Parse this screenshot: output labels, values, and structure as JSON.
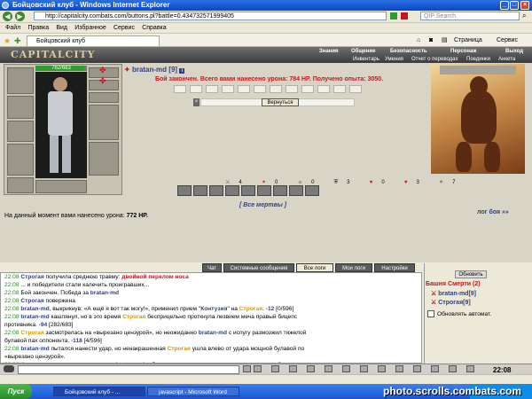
{
  "window": {
    "title": "Бойцовский клуб - Windows Internet Explorer"
  },
  "browser": {
    "address": "http://capitalcity.combats.com/buttons.pl?battle=0.434732571999405",
    "search_placeholder": "QIP Search",
    "menu": [
      "Файл",
      "Правка",
      "Вид",
      "Избранное",
      "Сервис",
      "Справка"
    ],
    "tab_title": "Бойцовский клуб",
    "page_menu": "Страница",
    "tools_menu": "Сервис"
  },
  "game": {
    "logo": "CAPITALCITY",
    "nav_top": [
      "Знания",
      "Общение",
      "Безопасность",
      "Персонаж",
      "Выход"
    ],
    "nav_sub": [
      "Инвентарь",
      "Умения",
      "Отчет о переводах",
      "Поединки",
      "Анкета"
    ],
    "hp_text": "762/683",
    "hp_fraction": 0.95,
    "player_name": "bratan-md",
    "player_level": "[9]",
    "battle_status": "Бой закончен. Всего вами нанесено урона: 784 HP. Получено опыта: 3050.",
    "back_button": "Вернуться",
    "stats": [
      "4",
      "0",
      "0",
      "3",
      "0",
      "3",
      "7"
    ],
    "all_dead": "[ Все мертвы ]",
    "battle_link": "лог боя »»",
    "damage_label": "На данный момент вами нанесено урона: ",
    "damage_value": "772 HP."
  },
  "chat": {
    "tabs": [
      "Чат",
      "Системные сообщения",
      "Все логи",
      "Мои логи",
      "Настройки"
    ],
    "lines": [
      {
        "time": "22:08",
        "parts": [
          {
            "t": "Строгая",
            "c": "nm"
          },
          {
            "t": " получила среднюю травму: ",
            "c": ""
          },
          {
            "t": "двойной перелом носа",
            "c": "red"
          }
        ]
      },
      {
        "time": "22:08",
        "parts": [
          {
            "t": "... и победители стали калечить проигравших...",
            "c": ""
          }
        ]
      },
      {
        "time": "22:08",
        "parts": [
          {
            "t": "Бой закончен. Победа за ",
            "c": ""
          },
          {
            "t": "bratan-md",
            "c": "nm"
          }
        ]
      },
      {
        "time": "22:08",
        "parts": [
          {
            "t": "Строгая",
            "c": "nm"
          },
          {
            "t": " повержена",
            "c": ""
          }
        ]
      },
      {
        "time": "22:08",
        "parts": [
          {
            "t": "bratan-md",
            "c": "nm"
          },
          {
            "t": ", выкрикнув: «А ещё я вот так могу!», применил прием \"",
            "c": ""
          },
          {
            "t": "Контузия",
            "c": "nm"
          },
          {
            "t": "\" на ",
            "c": ""
          },
          {
            "t": "Строгая",
            "c": "nm2"
          },
          {
            "t": ". ",
            "c": ""
          },
          {
            "t": "-12",
            "c": "blue"
          },
          {
            "t": " [0/596]",
            "c": ""
          }
        ]
      },
      {
        "time": "22:08",
        "parts": [
          {
            "t": "bratan-md",
            "c": "nm"
          },
          {
            "t": " кашлянул, но в это время ",
            "c": ""
          },
          {
            "t": "Строгая",
            "c": "nm2"
          },
          {
            "t": " бесприцельно проткнула лезвием меча правый бицепс",
            "c": ""
          }
        ]
      },
      {
        "time": "",
        "parts": [
          {
            "t": "противника. ",
            "c": ""
          },
          {
            "t": "-94",
            "c": "blue"
          },
          {
            "t": " [282/683]",
            "c": ""
          }
        ]
      },
      {
        "time": "22:08",
        "parts": [
          {
            "t": "Строгая",
            "c": "nm2"
          },
          {
            "t": " засмотрелась на «вырезано цензурой», но неожиданно ",
            "c": ""
          },
          {
            "t": "bratan-md",
            "c": "nm"
          },
          {
            "t": " с испугу размозжил тяжелой",
            "c": ""
          }
        ]
      },
      {
        "time": "",
        "parts": [
          {
            "t": "булавой пах оппонента. ",
            "c": ""
          },
          {
            "t": "-118",
            "c": "blue"
          },
          {
            "t": " [4/596]",
            "c": ""
          }
        ]
      },
      {
        "time": "22:08",
        "parts": [
          {
            "t": "bratan-md",
            "c": "nm"
          },
          {
            "t": " пытался нанести удар, но ненакрашенная ",
            "c": ""
          },
          {
            "t": "Строгая",
            "c": "nm2"
          },
          {
            "t": " ушла влево от удара мощной булавой по",
            "c": ""
          }
        ]
      },
      {
        "time": "",
        "parts": [
          {
            "t": "«вырезано цензурой».",
            "c": ""
          }
        ]
      },
      {
        "time": "22:08",
        "parts": [
          {
            "t": "Строгая",
            "c": "nm2"
          },
          {
            "t": " поскользнулась и потому ",
            "c": ""
          },
          {
            "t": "bratan-md",
            "c": "nm"
          },
          {
            "t": " отбил удар коленом меча по «вырезано цензурой».",
            "c": ""
          }
        ]
      }
    ],
    "refresh_button": "Обновить",
    "tower_title": "Башня Смерти (2)",
    "players": [
      "bratan-md[9]",
      "Строгая[9]"
    ],
    "auto_update": "Обновлять автомат."
  },
  "statusbar": {
    "clock": "22:08"
  },
  "taskbar": {
    "start": "Пуск",
    "tasks": [
      "Бойцовский клуб - ...",
      "javascript - Microsoft Word"
    ],
    "watermark": "photo.scrolls.combats.com"
  },
  "colors": {
    "accent": "#333f80",
    "danger": "#c4161c",
    "time": "#1f8a1f"
  }
}
